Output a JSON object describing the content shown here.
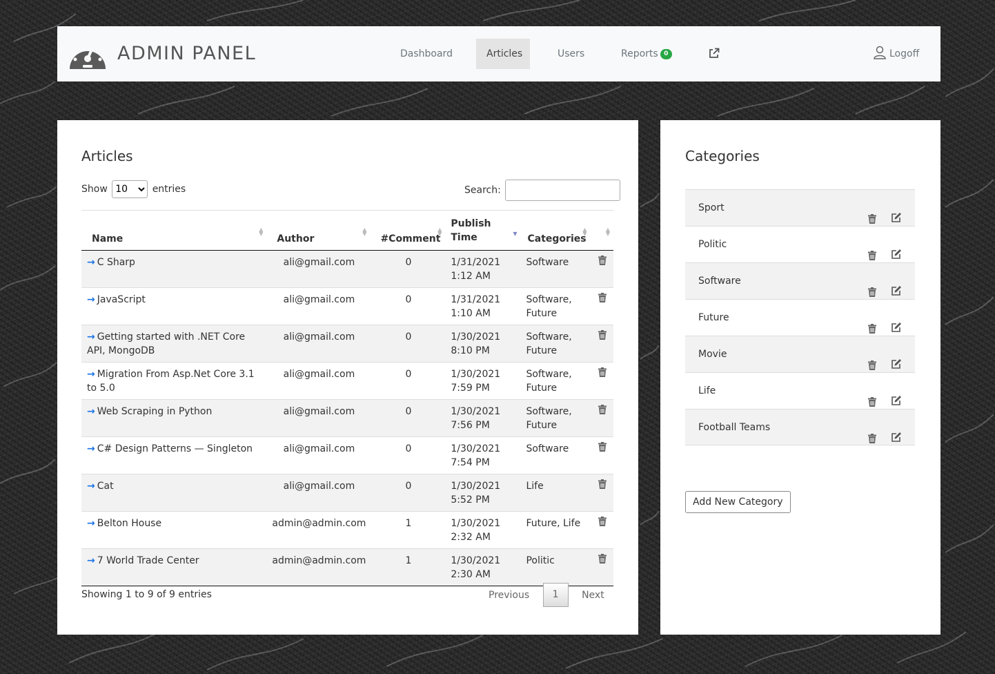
{
  "brand": {
    "title": "ADMIN PANEL"
  },
  "nav": {
    "items": [
      {
        "label": "Dashboard"
      },
      {
        "label": "Articles"
      },
      {
        "label": "Users"
      },
      {
        "label": "Reports",
        "badge": "0"
      }
    ],
    "logoff": "Logoff"
  },
  "articles": {
    "title": "Articles",
    "show_label": "Show",
    "entries_value": "10",
    "entries_label": "entries",
    "search_label": "Search:",
    "search_value": "",
    "columns": [
      "Name",
      "Author",
      "#Comment",
      "Publish Time",
      "Categories"
    ],
    "rows": [
      {
        "name": "C Sharp",
        "author": "ali@gmail.com",
        "comments": "0",
        "time": "1/31/2021 1:12 AM",
        "categories": "Software"
      },
      {
        "name": "JavaScript",
        "author": "ali@gmail.com",
        "comments": "0",
        "time": "1/31/2021 1:10 AM",
        "categories": "Software, Future"
      },
      {
        "name": "Getting started with .NET Core API, MongoDB",
        "author": "ali@gmail.com",
        "comments": "0",
        "time": "1/30/2021 8:10 PM",
        "categories": "Software, Future"
      },
      {
        "name": "Migration From Asp.Net Core 3.1 to 5.0",
        "author": "ali@gmail.com",
        "comments": "0",
        "time": "1/30/2021 7:59 PM",
        "categories": "Software, Future"
      },
      {
        "name": "Web Scraping in Python",
        "author": "ali@gmail.com",
        "comments": "0",
        "time": "1/30/2021 7:56 PM",
        "categories": "Software, Future"
      },
      {
        "name": "C# Design Patterns — Singleton",
        "author": "ali@gmail.com",
        "comments": "0",
        "time": "1/30/2021 7:54 PM",
        "categories": "Software"
      },
      {
        "name": "Cat",
        "author": "ali@gmail.com",
        "comments": "0",
        "time": "1/30/2021 5:52 PM",
        "categories": "Life"
      },
      {
        "name": "Belton House",
        "author": "admin@admin.com",
        "comments": "1",
        "time": "1/30/2021 2:32 AM",
        "categories": "Future, Life"
      },
      {
        "name": "7 World Trade Center",
        "author": "admin@admin.com",
        "comments": "1",
        "time": "1/30/2021 2:30 AM",
        "categories": "Politic"
      }
    ],
    "info": "Showing 1 to 9 of 9 entries",
    "pagination": {
      "previous": "Previous",
      "current": "1",
      "next": "Next"
    }
  },
  "categories": {
    "title": "Categories",
    "items": [
      "Sport",
      "Politic",
      "Software",
      "Future",
      "Movie",
      "Life",
      "Football Teams"
    ],
    "add_button": "Add New Category"
  },
  "colors": {
    "accent_link": "#1a73e8",
    "badge": "#28a745",
    "nav_bg": "#f8f9fa",
    "active_nav": "#e4e4e4"
  }
}
